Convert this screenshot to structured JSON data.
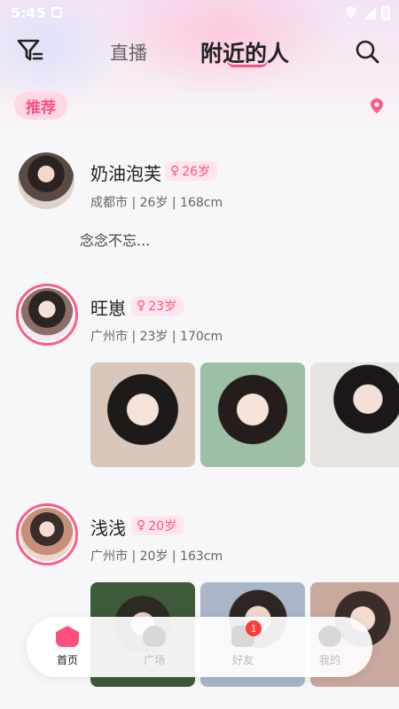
{
  "status_bar": {
    "time": "5:45"
  },
  "header": {
    "tabs": [
      {
        "label": "直播",
        "active": false
      },
      {
        "label": "附近的人",
        "active": true
      }
    ]
  },
  "sub_header": {
    "recommend_label": "推荐"
  },
  "users": [
    {
      "name": "奶油泡芙",
      "age": "26岁",
      "info": "成都市 | 26岁 | 168cm",
      "bio": "念念不忘...",
      "avatar_ring": false,
      "photos": []
    },
    {
      "name": "旺崽",
      "age": "23岁",
      "info": "广州市 | 23岁 | 170cm",
      "bio": "",
      "avatar_ring": true,
      "photos": [
        "photo-1",
        "photo-2",
        "photo-3"
      ]
    },
    {
      "name": "浅浅",
      "age": "20岁",
      "info": "广州市 | 20岁 | 163cm",
      "bio": "",
      "avatar_ring": true,
      "photos": [
        "photo-1",
        "photo-2",
        "photo-3"
      ]
    }
  ],
  "tabbar": {
    "items": [
      {
        "label": "首页",
        "icon": "home-icon",
        "active": true
      },
      {
        "label": "广场",
        "icon": "plaza-icon",
        "active": false
      },
      {
        "label": "好友",
        "icon": "chat-icon",
        "active": false,
        "badge": "1"
      },
      {
        "label": "我的",
        "icon": "profile-icon",
        "active": false
      }
    ]
  },
  "colors": {
    "accent": "#ff4f7f",
    "badge_bg": "#ffe5ec"
  }
}
